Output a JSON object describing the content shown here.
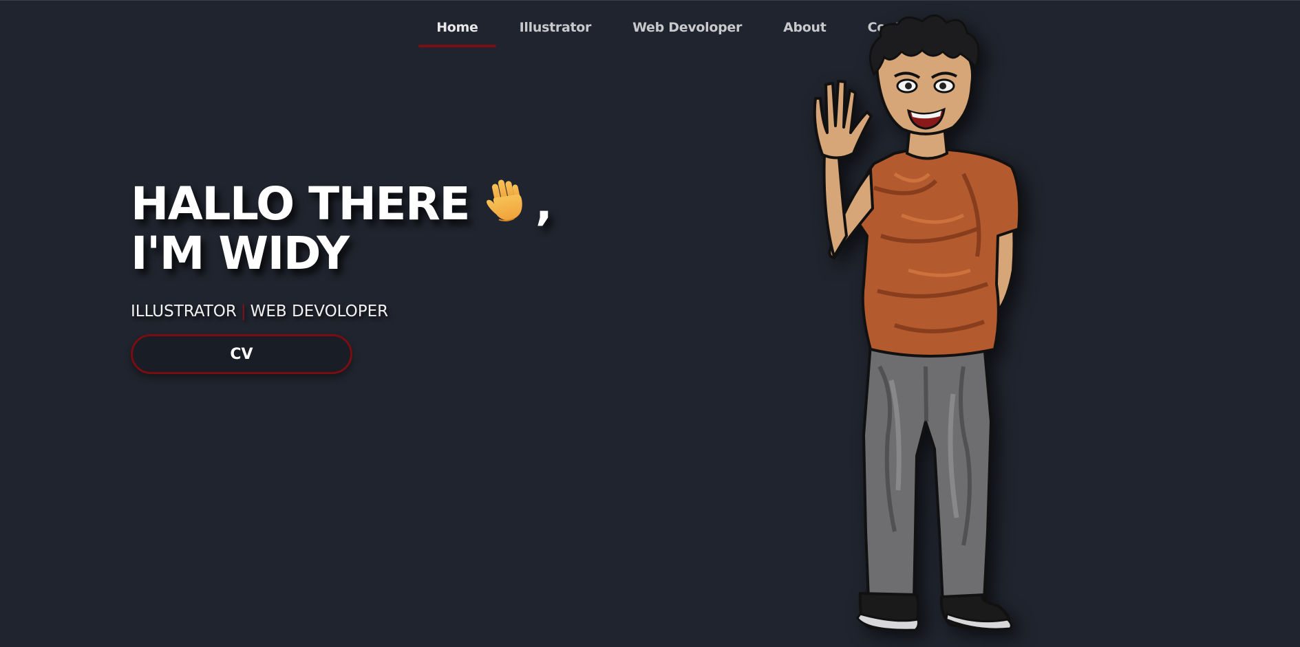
{
  "nav": {
    "items": [
      {
        "label": "Home",
        "active": true
      },
      {
        "label": "Illustrator"
      },
      {
        "label": "Web Devoloper"
      },
      {
        "label": "About"
      },
      {
        "label": "Contack"
      }
    ]
  },
  "hero": {
    "line1": "HALLO THERE",
    "comma": ",",
    "line2": "I'M WIDY",
    "wave_icon": "waving-hand-icon",
    "sub_left": "ILLUSTRATOR",
    "sub_sep": "|",
    "sub_right": "WEB DEVOLOPER",
    "cv_label": "CV"
  },
  "colors": {
    "background": "#20242e",
    "accent": "#7a0f14",
    "button_bg": "#191d25",
    "text": "#ffffff",
    "nav_text": "#c8c9cc"
  }
}
